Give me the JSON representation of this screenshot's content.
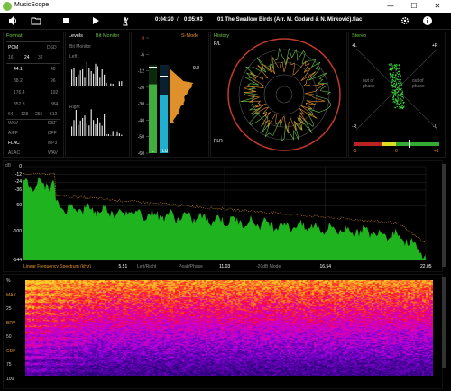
{
  "app": {
    "title": "MusicScope"
  },
  "window_controls": {
    "minimize": "—",
    "maximize": "☐",
    "close": "✕"
  },
  "toolbar": {
    "elapsed": "0:04:20",
    "separator": "/",
    "total": "0:05:03",
    "track": "01 The Swallow Birds (Arr. M. Godard & N. Mirković).flac"
  },
  "format_panel": {
    "title": "Format",
    "pcm": "PCM",
    "dsd": "DSD",
    "bits": [
      "16",
      "24",
      "32"
    ],
    "rates_left": [
      "44.1",
      "88.2",
      "176.4",
      "352.8"
    ],
    "rates_right": [
      "48",
      "96",
      "192",
      "384"
    ],
    "dsd_rates": [
      "64",
      "128",
      "256",
      "512"
    ],
    "codecs_left": [
      "WAV",
      "AIFF",
      "FLAC",
      "ALAC"
    ],
    "codecs_right": [
      "DSF",
      "DFF",
      "MP3",
      "WAV"
    ]
  },
  "levels_panel": {
    "title": "Levels",
    "mode": "Bit Monitor",
    "bit_monitor": "Bit Monitor",
    "left": "Left",
    "right": "Right"
  },
  "meter_panel": {
    "smode": "S-Mode",
    "scale": [
      "0",
      "-6",
      "-12",
      "-20",
      "-30",
      "-40",
      "-50",
      "-60"
    ],
    "peak": "9.8",
    "l": "L",
    "r": "LU",
    "level_left": 0.78,
    "level_right": 0.66,
    "lu_level": 0.62
  },
  "history_panel": {
    "title": "History",
    "pl": "P/L",
    "plr": "PLR"
  },
  "stereo_panel": {
    "title": "Stereo",
    "pl": "+L",
    "pr": "+R",
    "ml": "-R",
    "mr": "-L",
    "out_left": "out of phase",
    "out_right": "out of phase",
    "corr_left": "-1",
    "corr_mid": "0",
    "corr_right": "+1"
  },
  "spectrum": {
    "ylabels": [
      "0",
      "-12",
      "-24",
      "-36",
      "-60",
      "-100",
      "-144"
    ],
    "xlabels": [
      "0",
      "5.51",
      "11.03",
      "16.54",
      "22.05"
    ],
    "mode_labels": [
      "Linear Frequency Spectrum (kHz)",
      "Left/Right",
      "Peak/Phase",
      "-20dB Mode"
    ],
    "db": "dB"
  },
  "spectrogram": {
    "ylabels": [
      "%",
      "MAX",
      "25",
      "BRV",
      "50",
      "CDF",
      "75",
      "100"
    ]
  }
}
